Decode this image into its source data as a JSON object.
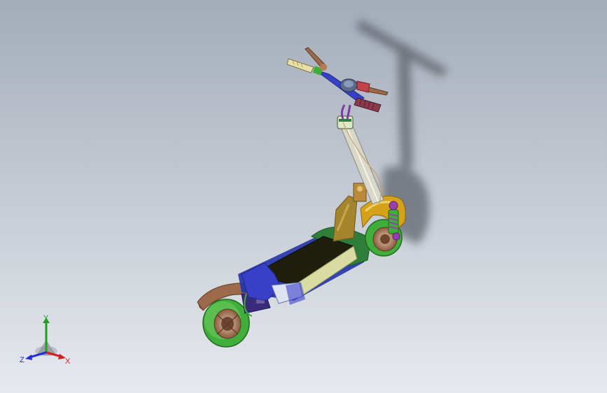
{
  "viewport": {
    "background_top": "#a3acb9",
    "background_bottom": "#e6e9ee"
  },
  "model": {
    "colors": {
      "tire": "#3fae3a",
      "tire_highlight": "#8fe07a",
      "fender_front": "#d6a21a",
      "fender_rear": "#9c6a4a",
      "deck_top": "#1f1f0e",
      "deck_side_front": "#2e7d3a",
      "deck_side_rear": "#2333a8",
      "stem": "#d8d8c8",
      "handlebar": "#3940c8",
      "grip": "#8a3a4a",
      "bracket": "#a5842e",
      "suspension": "#9a3fb0",
      "shadow": "#3b3f46"
    }
  },
  "triad": {
    "x_label": "X",
    "y_label": "Y",
    "z_label": "Z",
    "x_color": "#d11f1f",
    "y_color": "#1f9e1f",
    "z_color": "#1f2fd1"
  }
}
